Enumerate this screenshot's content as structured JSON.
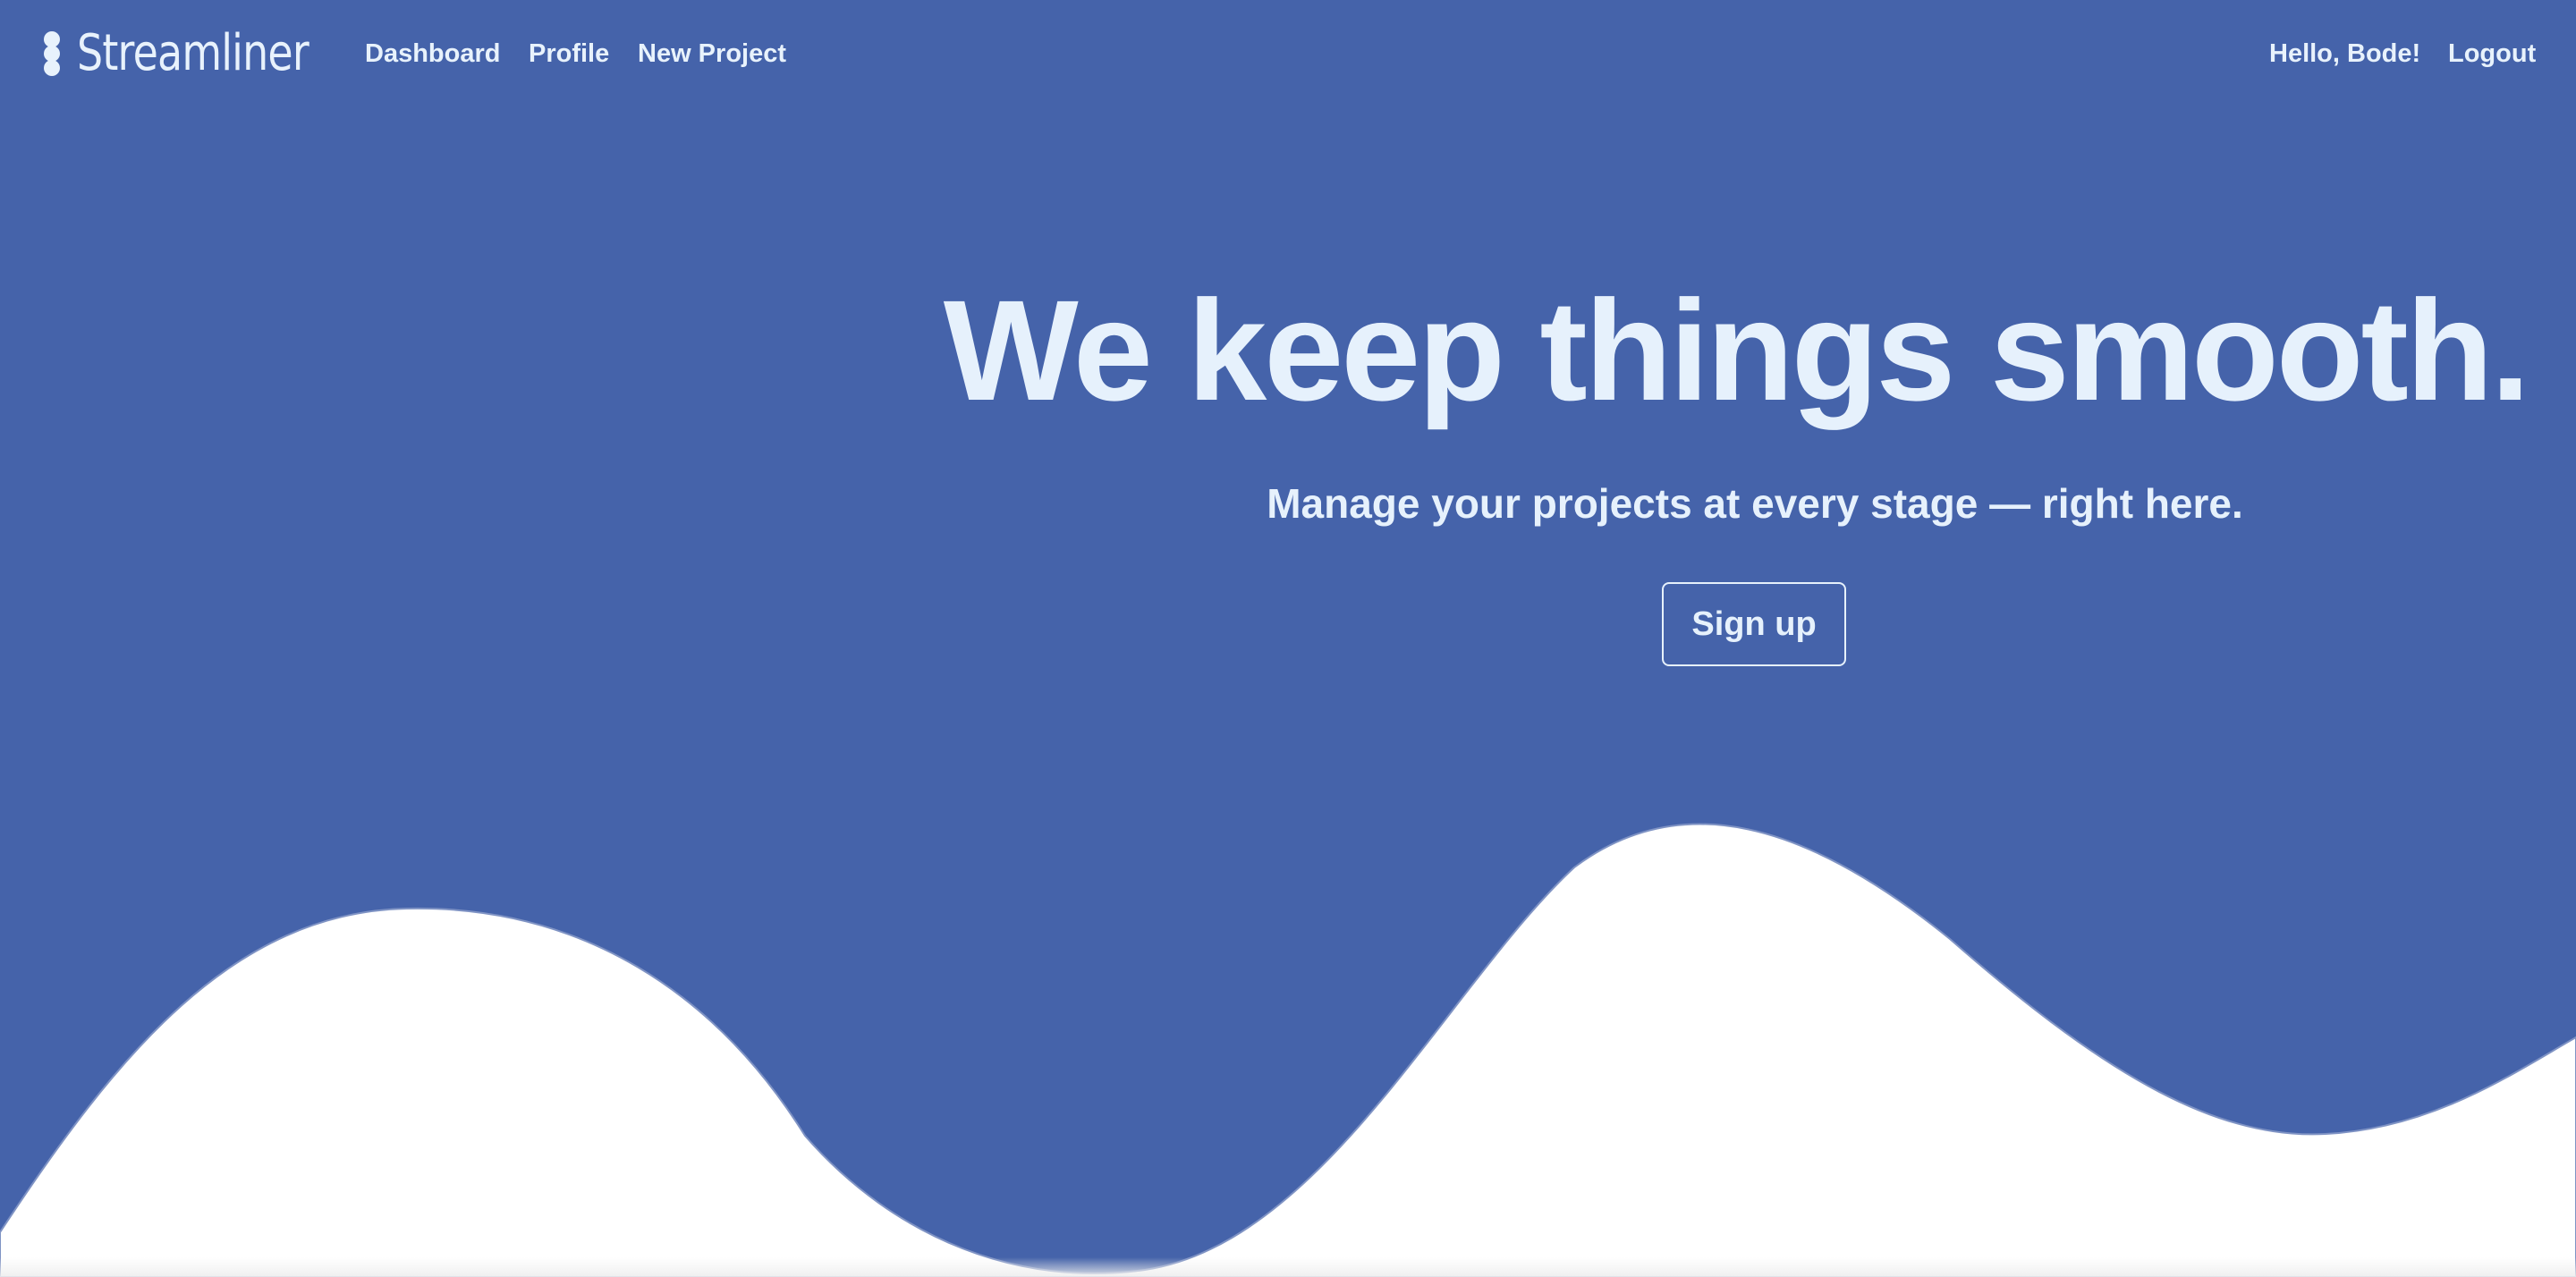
{
  "colors": {
    "hero_background": "#4563aa",
    "hero_text": "#e6f1fc",
    "wave_fill": "#ffffff"
  },
  "navbar": {
    "brand": {
      "name": "Streamliner",
      "icon": "three-dots-vertical-icon"
    },
    "links": [
      {
        "label": "Dashboard"
      },
      {
        "label": "Profile"
      },
      {
        "label": "New Project"
      }
    ],
    "greeting": "Hello, Bode!",
    "logout_label": "Logout"
  },
  "hero": {
    "title": "We keep things smooth.",
    "subtitle": "Manage your projects at every stage — right here.",
    "cta_label": "Sign up"
  }
}
